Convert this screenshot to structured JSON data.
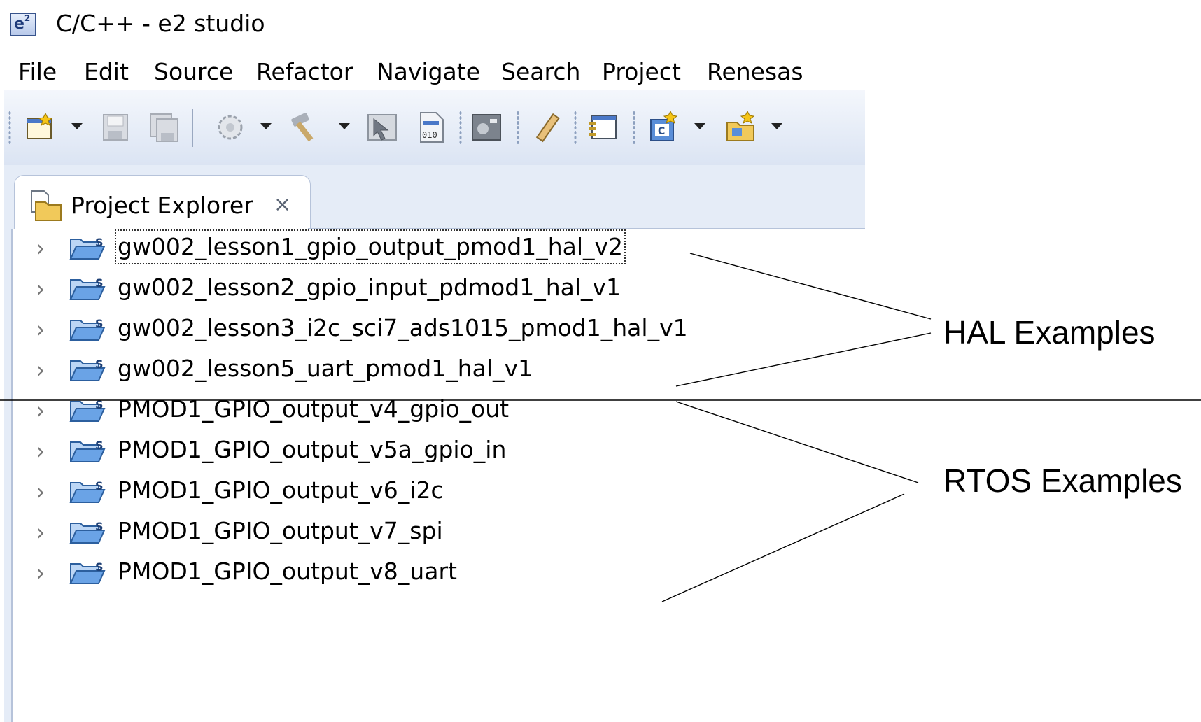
{
  "window": {
    "app_icon_text": "e",
    "app_icon_sup": "2",
    "title": "C/C++ - e2 studio"
  },
  "menu": [
    "File",
    "Edit",
    "Source",
    "Refactor",
    "Navigate",
    "Search",
    "Project",
    "Renesas"
  ],
  "toolbar": {
    "icons": [
      "new-icon",
      "save-icon",
      "save-all-icon",
      "build-config-icon",
      "build-hammer-icon",
      "debug-icon",
      "binary-file-icon",
      "terminal-icon",
      "pencil-icon",
      "editor-icon",
      "new-c-project-icon",
      "new-folder-icon"
    ]
  },
  "view": {
    "tab_label": "Project Explorer",
    "tab_close_glyph": "⨯",
    "expand_glyph": "›",
    "tree": [
      "gw002_lesson1_gpio_output_pmod1_hal_v2",
      "gw002_lesson2_gpio_input_pdmod1_hal_v1",
      "gw002_lesson3_i2c_sci7_ads1015_pmod1_hal_v1",
      "gw002_lesson5_uart_pmod1_hal_v1",
      "PMOD1_GPIO_output_v4_gpio_out",
      "PMOD1_GPIO_output_v5a_gpio_in",
      "PMOD1_GPIO_output_v6_i2c",
      "PMOD1_GPIO_output_v7_spi",
      "PMOD1_GPIO_output_v8_uart"
    ]
  },
  "annotations": {
    "hal": "HAL Examples",
    "rtos": "RTOS Examples"
  },
  "colors": {
    "toolbar_top": "#f4f7fc",
    "toolbar_bottom": "#dbe4f3",
    "view_background": "#e5ecf7",
    "folder_blue": "#4a8fdc"
  }
}
